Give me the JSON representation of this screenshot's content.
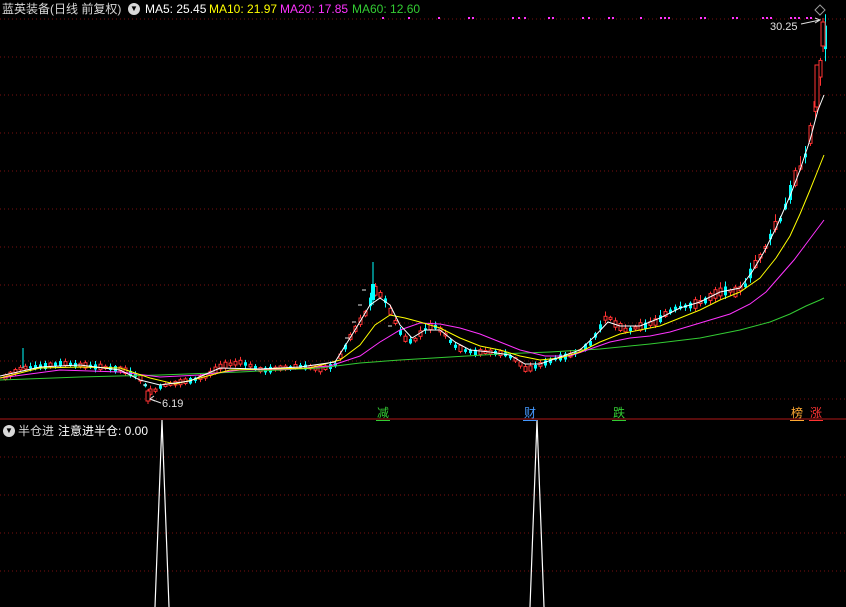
{
  "title": "蓝英装备(日线 前复权)",
  "ma": [
    {
      "label": "MA5: 25.45",
      "color": "#ffffff"
    },
    {
      "label": "MA10: 21.97",
      "color": "#ffff00"
    },
    {
      "label": "MA20: 17.85",
      "color": "#ff33ff"
    },
    {
      "label": "MA60: 12.60",
      "color": "#33cc33"
    }
  ],
  "high_label": "30.25",
  "low_label": "6.19",
  "signals": [
    {
      "text": "减",
      "color": "#33cc33"
    },
    {
      "text": "财",
      "color": "#4499ff"
    },
    {
      "text": "跌",
      "color": "#33cc33"
    },
    {
      "text": "榜",
      "color": "#ffaa33"
    },
    {
      "text": "涨",
      "color": "#ff3333"
    }
  ],
  "indicator": {
    "name": "半仓进",
    "label": "注意进半仓: 0.00"
  },
  "colors": {
    "up": "#ff3333",
    "down": "#00ffff",
    "grid": "#7a1010",
    "ma5": "#ffffff",
    "ma10": "#ffff00",
    "ma20": "#ff33ff",
    "ma60": "#33cc33",
    "marker": "#ff33ff"
  }
}
